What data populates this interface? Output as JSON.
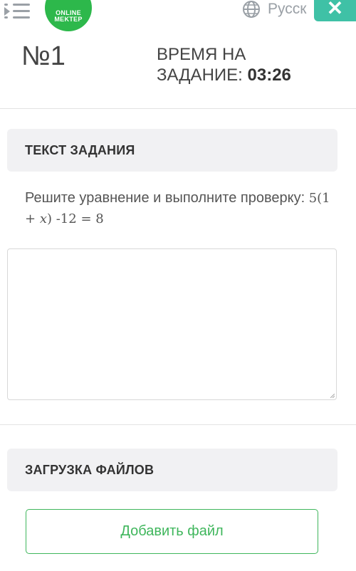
{
  "header": {
    "logo": {
      "line1": "ONLINE",
      "line2": "MEKTEP"
    },
    "language_label": "Русск",
    "close_symbol": "✕"
  },
  "task": {
    "number": "№1",
    "timer_label_line1": "ВРЕМЯ НА",
    "timer_label_line2": "ЗАДАНИЕ:",
    "timer_value": "03:26"
  },
  "task_section": {
    "title": "ТЕКСТ ЗАДАНИЯ",
    "text": "Решите уравнение и выполните проверку:",
    "formula_a": "5(1 + ",
    "formula_var": "x",
    "formula_b": ")",
    "formula_c": " -12 ",
    "formula_d": "= 8"
  },
  "answer": {
    "value": ""
  },
  "upload_section": {
    "title": "ЗАГРУЗКА ФАЙЛОВ",
    "button_label": "Добавить файл"
  },
  "icons": {
    "menu": "menu-collapse-icon",
    "globe": "globe-icon",
    "close": "close-icon"
  },
  "colors": {
    "brand_green": "#2db84b",
    "close_teal": "#3fc1a6",
    "button_green": "#3fb65c"
  }
}
